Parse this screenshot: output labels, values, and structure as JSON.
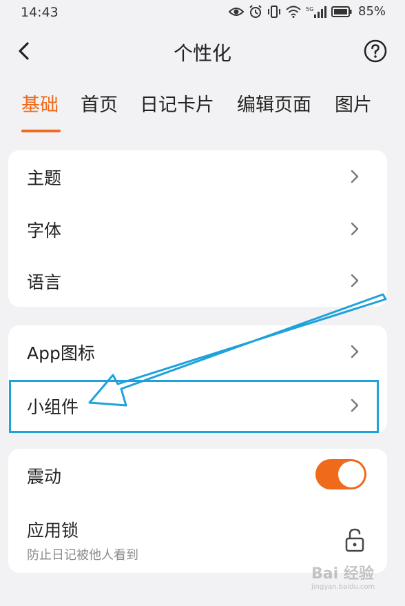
{
  "status_bar": {
    "time": "14:43",
    "network": "5G",
    "battery_percent": "85%",
    "icons": [
      "eye-icon",
      "alarm-icon",
      "vibrate-icon",
      "wifi-icon",
      "signal-icon",
      "battery-icon"
    ]
  },
  "header": {
    "title": "个性化",
    "back_icon": "chevron-left-icon",
    "help_icon": "question-circle-icon"
  },
  "tabs": [
    {
      "label": "基础",
      "active": true
    },
    {
      "label": "首页",
      "active": false
    },
    {
      "label": "日记卡片",
      "active": false
    },
    {
      "label": "编辑页面",
      "active": false
    },
    {
      "label": "图片",
      "active": false
    }
  ],
  "groups": {
    "basic": [
      {
        "label": "主题"
      },
      {
        "label": "字体"
      },
      {
        "label": "语言"
      }
    ],
    "icons": [
      {
        "label": "App图标"
      },
      {
        "label": "小组件"
      }
    ],
    "other": {
      "vibration": {
        "label": "震动",
        "enabled": true
      },
      "app_lock": {
        "label": "应用锁",
        "description": "防止日记被他人看到",
        "icon": "lock-open-icon"
      }
    }
  },
  "colors": {
    "accent": "#ef6a1b",
    "annotation": "#1fa1dc",
    "background": "#f2f2f4",
    "card": "#ffffff"
  },
  "watermark": {
    "text": "Bai 经验",
    "sub": "jingyan.baidu.com"
  }
}
